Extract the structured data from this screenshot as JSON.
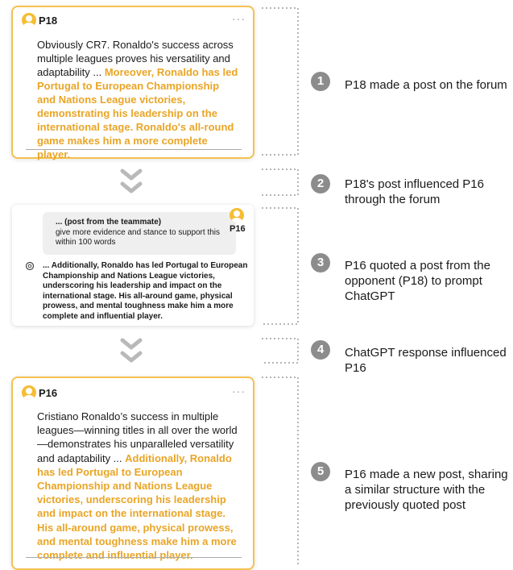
{
  "post_top": {
    "user": "P18",
    "menu": "···",
    "text_plain": "Obviously CR7. Ronaldo's success across multiple leagues proves his versatility and adaptability ... ",
    "text_highlight": "Moreover, Ronaldo has led Portugal to European Championship and Nations League victories, demonstrating his leadership on the international stage. Ronaldo's all-round game makes him a more complete player."
  },
  "chat": {
    "user": "P16",
    "prompt_title": "... (post from the teammate)",
    "prompt_text": "give more evidence and stance to support this within 100 words",
    "gpt_icon": "chatgpt-icon",
    "response": "... Additionally, Ronaldo has led Portugal to European Championship and Nations League victories, underscoring his leadership and impact on the international stage. His all-around game, physical prowess, and mental toughness make him a more complete and influential player."
  },
  "post_bottom": {
    "user": "P16",
    "menu": "···",
    "text_plain": "Cristiano Ronaldo’s success in multiple leagues—winning titles in all over the world—demonstrates his unparalleled versatility and adaptability ... ",
    "text_highlight": "Additionally, Ronaldo has led Portugal to European Championship and Nations League victories, underscoring his leadership and impact on the international stage. His all-around game, physical prowess, and mental toughness make him a more complete and influential player."
  },
  "steps": [
    {
      "num": "1",
      "text": "P18 made a post on the forum"
    },
    {
      "num": "2",
      "text": "P18's post influenced P16 through the forum"
    },
    {
      "num": "3",
      "text": "P16 quoted a post from the opponent (P18) to prompt ChatGPT"
    },
    {
      "num": "4",
      "text": "ChatGPT response influenced P16"
    },
    {
      "num": "5",
      "text": "P16 made a new post, sharing a similar structure with the previously quoted post"
    }
  ],
  "colors": {
    "highlight": "#e9a526",
    "border": "#f5c150",
    "step_circle": "#8c8c8c",
    "connector": "#b5b5b5"
  }
}
